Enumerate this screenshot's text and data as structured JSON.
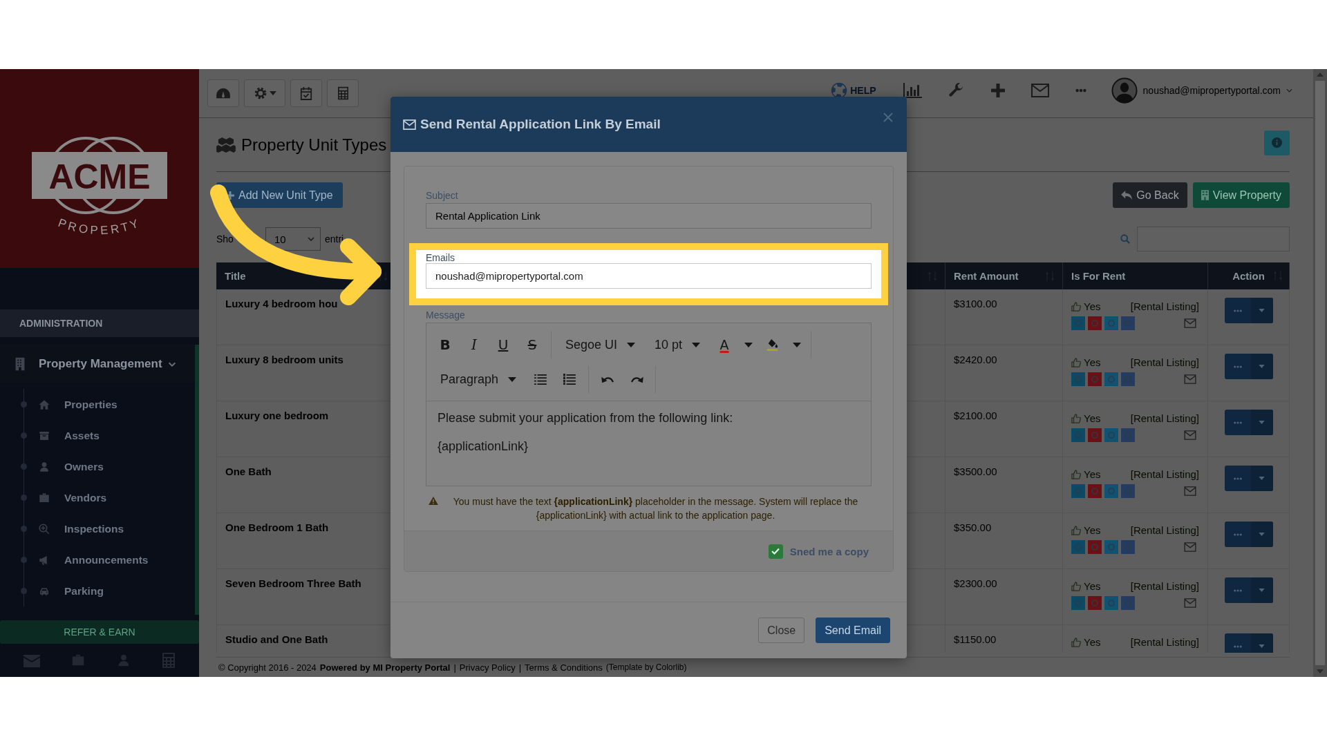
{
  "logo": {
    "name": "ACME",
    "tagline": "PROPERTY"
  },
  "sidebar": {
    "section": "ADMINISTRATION",
    "group": {
      "label": "Property Management",
      "expanded": true,
      "children": [
        {
          "label": "Properties"
        },
        {
          "label": "Assets"
        },
        {
          "label": "Owners"
        },
        {
          "label": "Vendors"
        },
        {
          "label": "Inspections"
        },
        {
          "label": "Announcements"
        },
        {
          "label": "Parking"
        }
      ]
    },
    "refer_button": "REFER & EARN"
  },
  "topbar": {
    "help": "HELP",
    "user_email": "noushad@mipropertyportal.com"
  },
  "page": {
    "title": "Property Unit Types",
    "add_button": "Add New Unit Type",
    "back_button": "Go Back",
    "view_button": "View Property",
    "length": {
      "before": "Sho",
      "value": "10",
      "after": "entri"
    }
  },
  "table": {
    "columns": [
      "Title",
      "Rent Amount",
      "Is For Rent",
      "Action"
    ],
    "rows": [
      {
        "title": "Luxury 4 bedroom hou",
        "rent": "$3100.00",
        "for_rent": "Yes",
        "listing": "[Rental Listing]"
      },
      {
        "title": "Luxury 8 bedroom units",
        "rent": "$2420.00",
        "for_rent": "Yes",
        "listing": "[Rental Listing]"
      },
      {
        "title": "Luxury one bedroom",
        "rent": "$2100.00",
        "for_rent": "Yes",
        "listing": "[Rental Listing]"
      },
      {
        "title": "One Bath",
        "rent": "$3500.00",
        "for_rent": "Yes",
        "listing": "[Rental Listing]"
      },
      {
        "title": "One Bedroom 1 Bath",
        "rent": "$350.00",
        "for_rent": "Yes",
        "listing": "[Rental Listing]"
      },
      {
        "title": "Seven Bedroom Three Bath",
        "rent": "$2300.00",
        "for_rent": "Yes",
        "listing": "[Rental Listing]"
      },
      {
        "title": "Studio and One Bath",
        "rent": "$1150.00",
        "for_rent": "Yes",
        "listing": "[Rental Listing]"
      }
    ]
  },
  "footer": [
    {
      "kind": "text",
      "text": "© Copyright 2016 - 2024"
    },
    {
      "kind": "strong",
      "text": "Powered by MI Property Portal"
    },
    {
      "kind": "text",
      "text": "|"
    },
    {
      "kind": "link",
      "text": "Privacy Policy"
    },
    {
      "kind": "text",
      "text": "|"
    },
    {
      "kind": "link",
      "text": "Terms & Conditions"
    },
    {
      "kind": "small",
      "text": "(Template by Colorlib)"
    }
  ],
  "modal": {
    "title": "Send Rental Application Link By Email",
    "subject": {
      "label": "Subject",
      "value": "Rental Application Link"
    },
    "emails": {
      "label": "Emails",
      "value": "noushad@mipropertyportal.com"
    },
    "message": {
      "label": "Message",
      "toolbar": [
        {
          "groups": [
            {
              "items": [
                {
                  "kind": "bold",
                  "label": "B"
                },
                {
                  "kind": "italic",
                  "label": "I"
                },
                {
                  "kind": "underline",
                  "label": "U"
                },
                {
                  "kind": "strike",
                  "label": "S"
                }
              ]
            },
            {
              "items": [
                {
                  "kind": "font",
                  "label": "Segoe UI"
                },
                {
                  "kind": "size",
                  "label": "10 pt"
                },
                {
                  "kind": "forecolor",
                  "label": "A"
                },
                {
                  "kind": "backcolor"
                }
              ]
            }
          ]
        },
        {
          "groups": [
            {
              "items": [
                {
                  "kind": "block",
                  "label": "Paragraph"
                },
                {
                  "kind": "bullist"
                },
                {
                  "kind": "numlist"
                }
              ]
            },
            {
              "items": [
                {
                  "kind": "undo"
                },
                {
                  "kind": "redo"
                }
              ]
            }
          ]
        }
      ],
      "paragraphs": [
        "Please submit your application from the following link:",
        "{applicationLink}"
      ]
    },
    "warning": "You must have the text **{applicationLink}** placeholder in the message. System will replace the {applicationLink} with actual link to the application page.",
    "copy": {
      "label": "Sned me a copy",
      "checked": true
    },
    "buttons": [
      {
        "label": "Close",
        "kind": "default"
      },
      {
        "label": "Send Email",
        "kind": "primary"
      }
    ]
  }
}
